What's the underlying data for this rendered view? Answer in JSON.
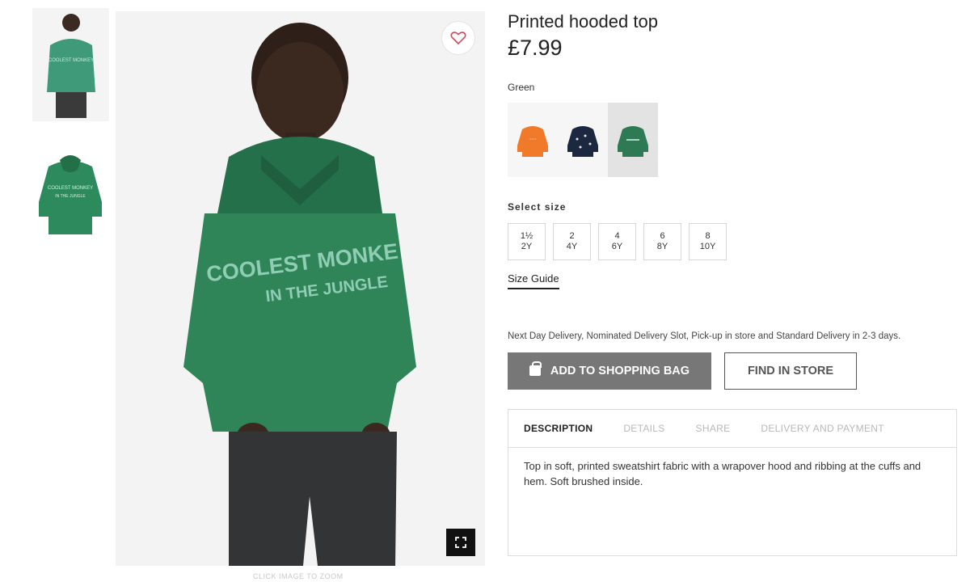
{
  "product": {
    "title": "Printed hooded top",
    "price": "£7.99",
    "color_selected": "Green",
    "swatches": [
      {
        "color": "#f07a2a",
        "name": "orange"
      },
      {
        "color": "#1b2840",
        "name": "navy"
      },
      {
        "color": "#2d7a55",
        "name": "green"
      }
    ]
  },
  "sizes": {
    "label": "Select size",
    "options": [
      {
        "top": "1½",
        "bottom": "2Y"
      },
      {
        "top": "2",
        "bottom": "4Y"
      },
      {
        "top": "4",
        "bottom": "6Y"
      },
      {
        "top": "6",
        "bottom": "8Y"
      },
      {
        "top": "8",
        "bottom": "10Y"
      }
    ],
    "guide_label": "Size Guide"
  },
  "delivery_text": "Next Day Delivery, Nominated Delivery Slot, Pick-up in store and Standard Delivery in 2-3 days.",
  "buttons": {
    "add_to_bag": "ADD TO SHOPPING BAG",
    "find_in_store": "FIND IN STORE"
  },
  "tabs": [
    "DESCRIPTION",
    "DETAILS",
    "SHARE",
    "DELIVERY AND PAYMENT"
  ],
  "description": "Top in soft, printed sweatshirt fabric with a wrapover hood and ribbing at the cuffs and hem. Soft brushed inside.",
  "image": {
    "click_to_zoom": "CLICK IMAGE TO ZOOM",
    "print_line1": "COOLEST MONKE",
    "print_line2": "IN THE JUNGLE"
  },
  "colors": {
    "hoodie": "#2d7a55",
    "button_grey": "#777777"
  }
}
